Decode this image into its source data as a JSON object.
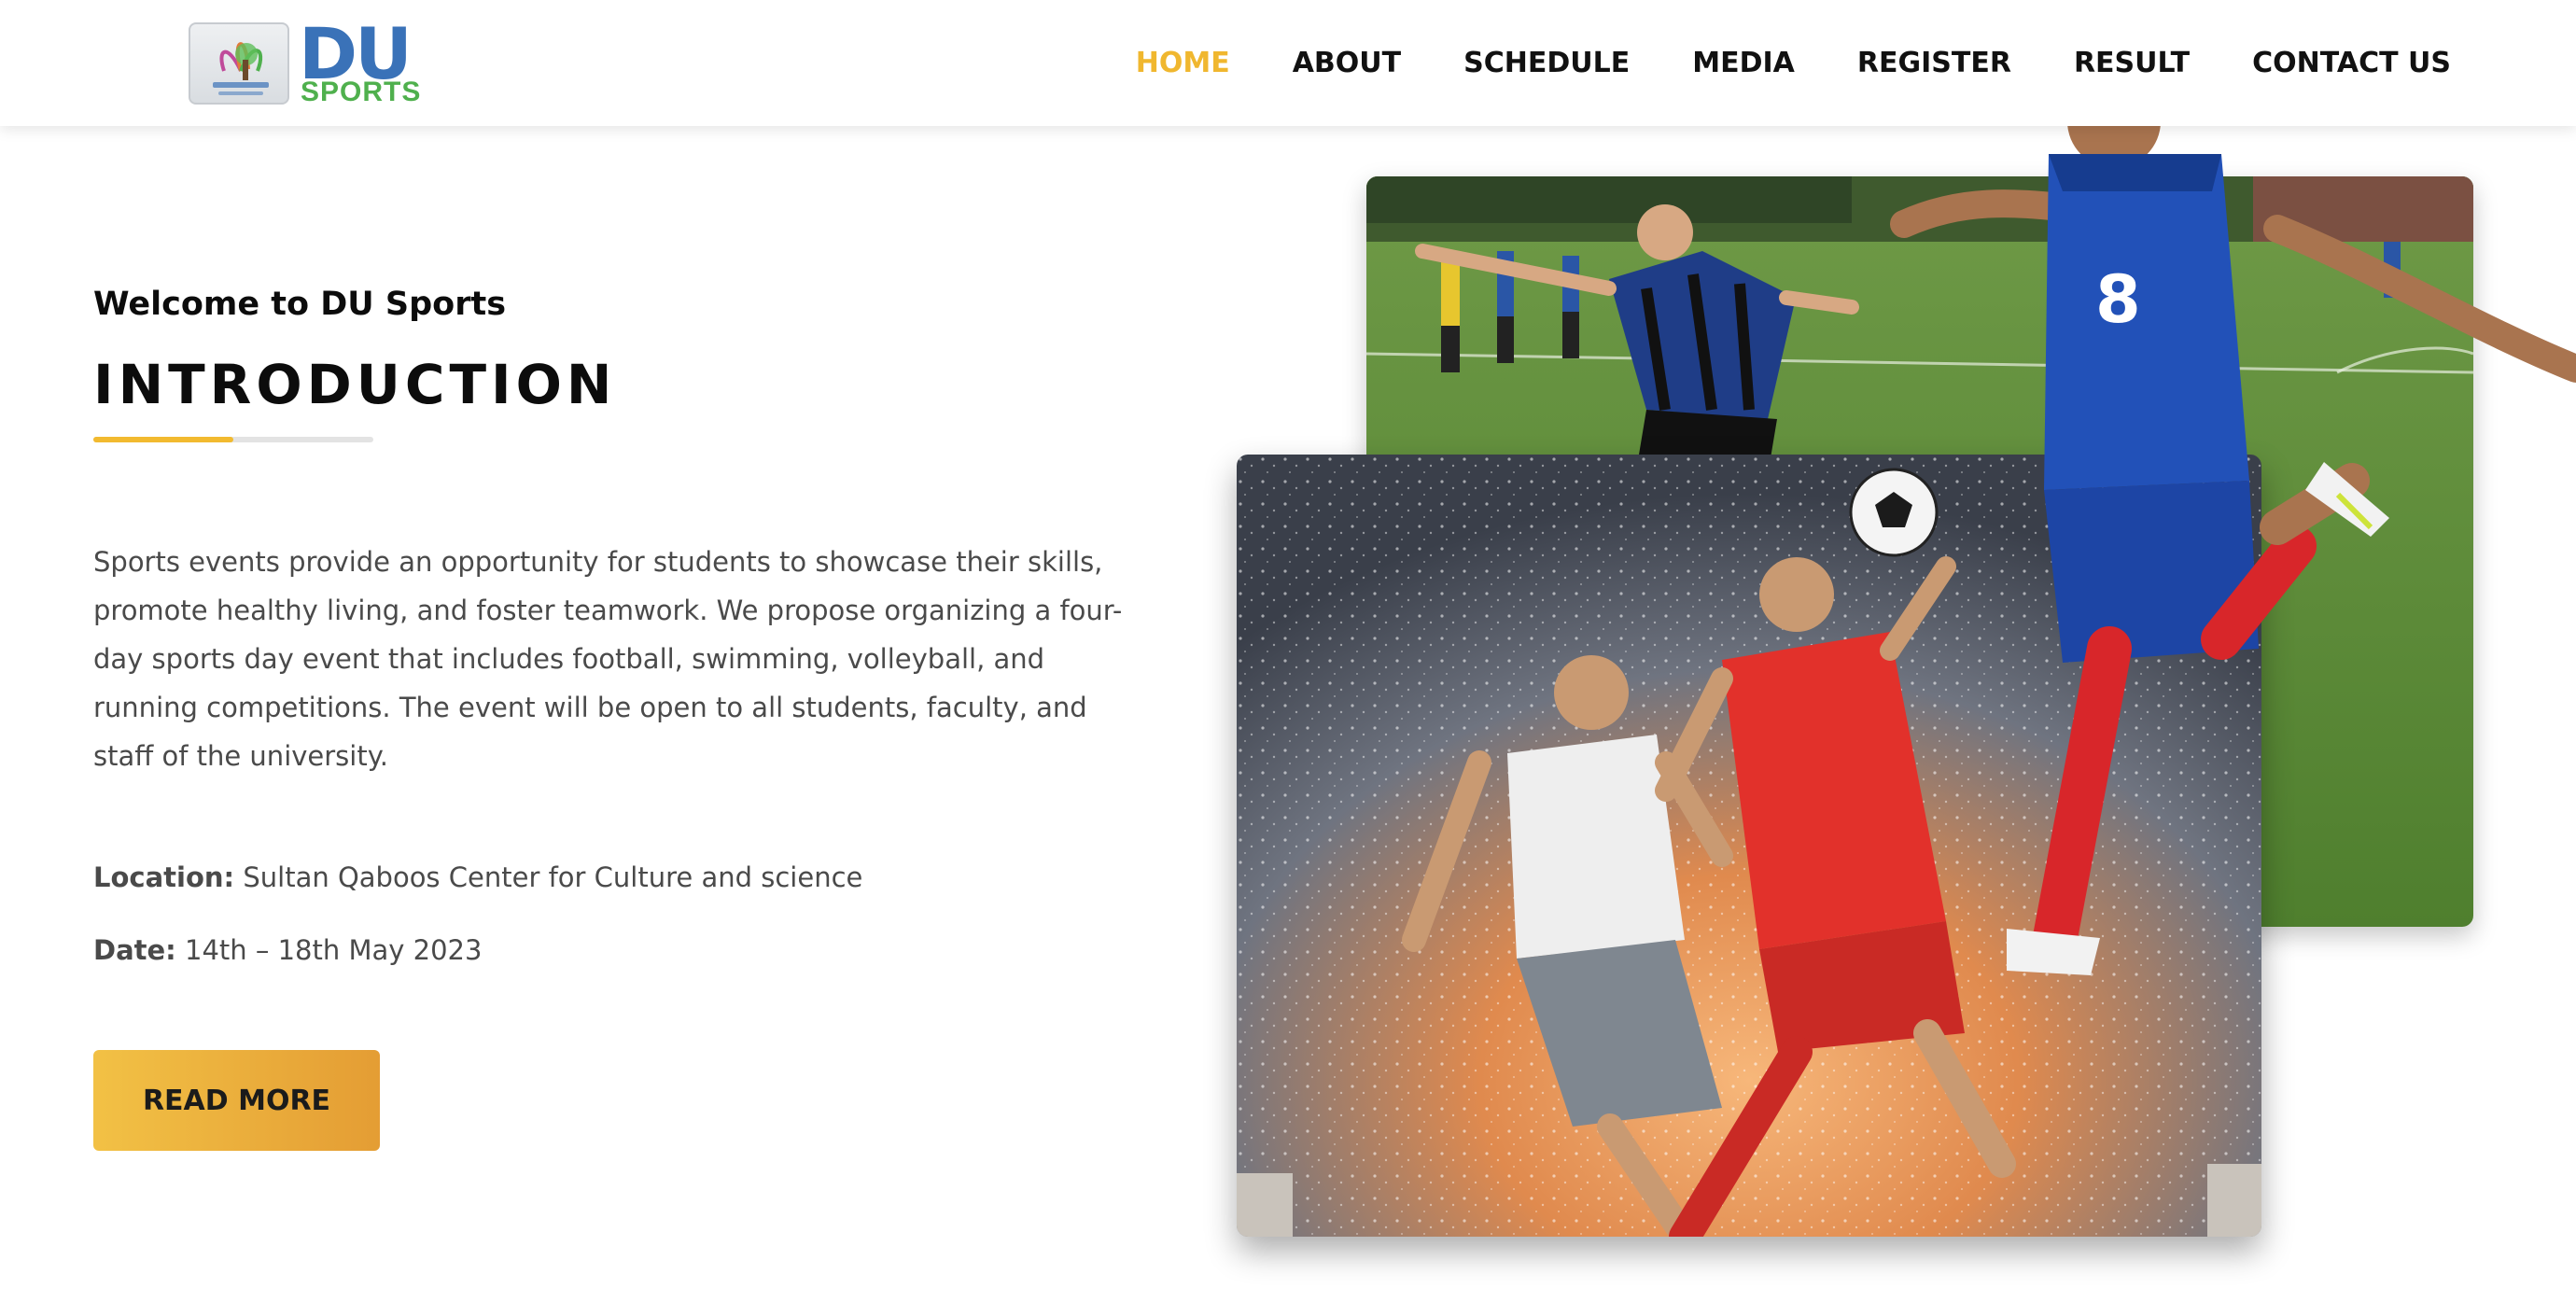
{
  "brand": {
    "logo_alt": "Dhofar University DU Sports",
    "du_text": "DU",
    "sports_text": "SPORTS"
  },
  "nav": {
    "items": [
      {
        "label": "HOME",
        "active": true
      },
      {
        "label": "ABOUT",
        "active": false
      },
      {
        "label": "SCHEDULE",
        "active": false
      },
      {
        "label": "MEDIA",
        "active": false
      },
      {
        "label": "REGISTER",
        "active": false
      },
      {
        "label": "RESULT",
        "active": false
      },
      {
        "label": "CONTACT US",
        "active": false
      }
    ]
  },
  "intro": {
    "eyebrow": "Welcome to DU Sports",
    "title": "INTRODUCTION",
    "description": "Sports events provide an opportunity for students to showcase their skills, promote healthy living, and foster teamwork. We propose organizing a four-day sports day event that includes football, swimming, volleyball, and running competitions. The event will be open to all students, faculty, and staff of the university.",
    "location_label": "Location:",
    "location_value": "Sultan Qaboos Center for Culture and science",
    "date_label": "Date:",
    "date_value": "14th – 18th May 2023",
    "button_label": "READ MORE"
  },
  "colors": {
    "accent": "#f2ba2f",
    "brand_blue": "#3a72b8",
    "brand_green": "#4fb04d"
  }
}
